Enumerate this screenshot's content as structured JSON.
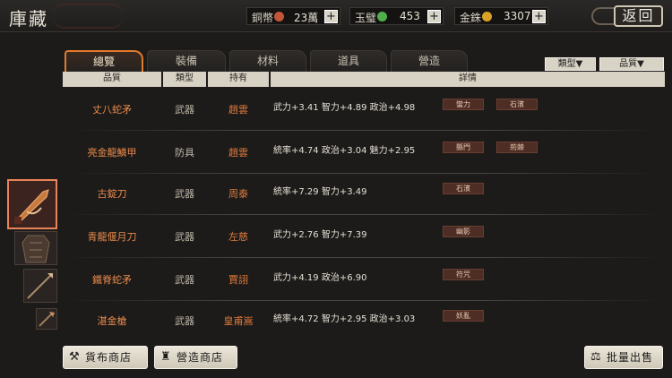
{
  "header": {
    "title": "庫藏",
    "back_label": "返回",
    "currencies": [
      {
        "name": "銅幣",
        "value": "23萬",
        "coin_color": "#c4553a"
      },
      {
        "name": "玉璧",
        "value": "453",
        "coin_color": "#4fb04a"
      },
      {
        "name": "金銖",
        "value": "3307",
        "coin_color": "#d9a227"
      }
    ],
    "plus_label": "+"
  },
  "tabs": [
    "總覽",
    "裝備",
    "材料",
    "道具",
    "營造"
  ],
  "active_tab": 0,
  "filters": {
    "type_label": "類型▼",
    "quality_label": "品質▼"
  },
  "columns": {
    "quality": "品質",
    "type": "類型",
    "holder": "持有",
    "details": "詳情"
  },
  "items": [
    {
      "name": "丈八蛇矛",
      "type": "武器",
      "holder": "趙雲",
      "stats": "武力+3.41 智力+4.89 政治+4.98",
      "tags": [
        "蠻力",
        "石濱"
      ]
    },
    {
      "name": "亮金龍鱗甲",
      "type": "防具",
      "holder": "趙雲",
      "stats": "統率+4.74 政治+3.04 魅力+2.95",
      "tags": [
        "縣門",
        "荊棘"
      ]
    },
    {
      "name": "古錠刀",
      "type": "武器",
      "holder": "周泰",
      "stats": "統率+7.29 智力+3.49",
      "tags": [
        "石濱"
      ]
    },
    {
      "name": "青龍偃月刀",
      "type": "武器",
      "holder": "左慈",
      "stats": "武力+2.76 智力+7.39",
      "tags": [
        "幽影"
      ]
    },
    {
      "name": "鐵脊蛇矛",
      "type": "武器",
      "holder": "賈詡",
      "stats": "武力+4.19 政治+6.90",
      "tags": [
        "符咒"
      ]
    },
    {
      "name": "湛金槍",
      "type": "武器",
      "holder": "皇甫嵩",
      "stats": "統率+4.72 智力+2.95 政治+3.03",
      "tags": [
        "妖亂"
      ]
    }
  ],
  "bottom": {
    "cloth_shop": "貨布商店",
    "build_shop": "營造商店",
    "bulk_sell": "批量出售"
  },
  "colors": {
    "accent": "#e27a2c",
    "item_name": "#e8894a",
    "tag_bg": "#4d2d24"
  }
}
